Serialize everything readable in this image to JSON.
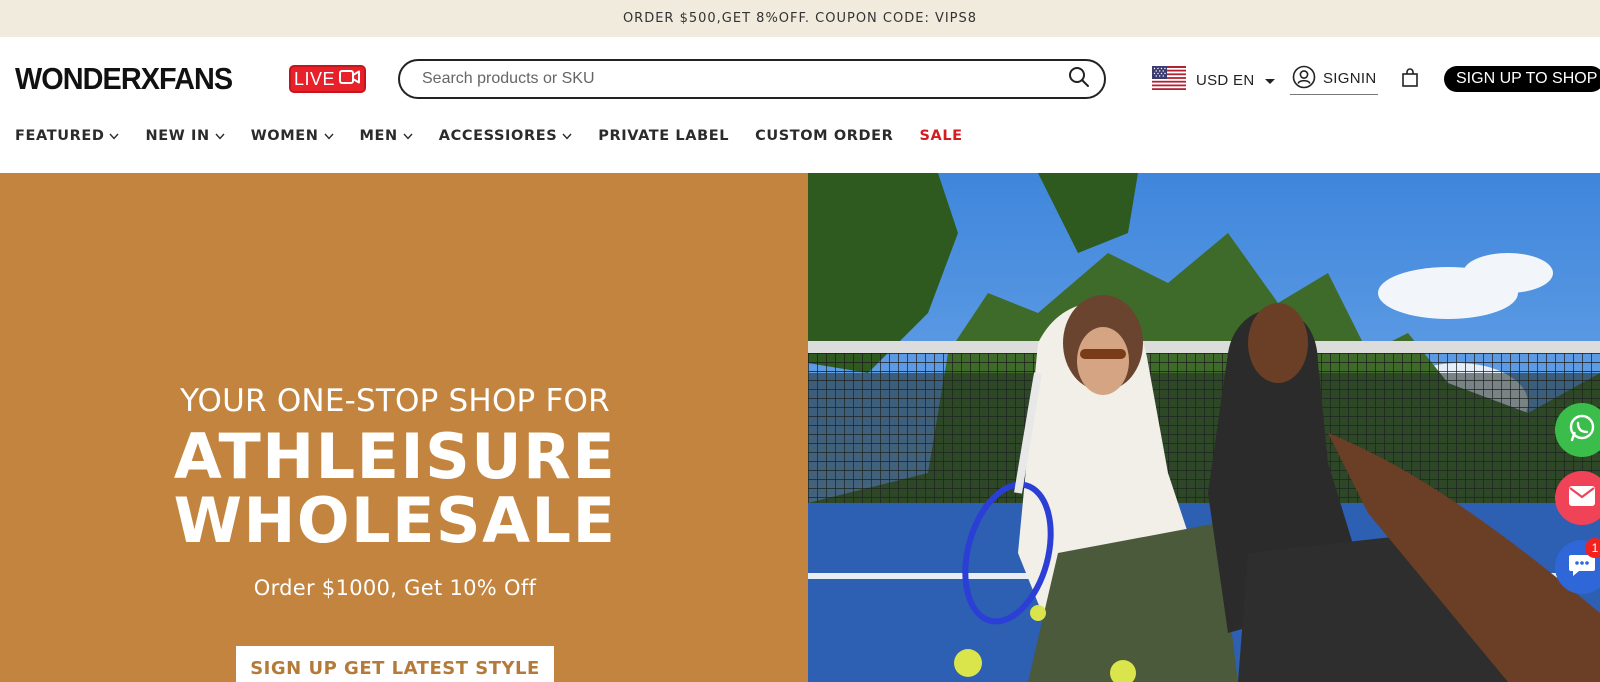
{
  "promo": {
    "text": "ORDER $500,GET 8%OFF. COUPON CODE: VIPS8"
  },
  "header": {
    "logo": "WONDERXFANS",
    "live_label": "LIVE",
    "search": {
      "placeholder": "Search products or SKU",
      "value": ""
    },
    "currency_label": "USD EN",
    "signin_label": "SIGNIN",
    "signup_label": "SIGN UP TO SHOP",
    "icons": [
      "video-camera-icon",
      "search-icon",
      "us-flag-icon",
      "caret-down-icon",
      "user-circle-icon",
      "shopping-bag-icon"
    ]
  },
  "nav": {
    "items": [
      {
        "label": "FEATURED",
        "dropdown": true
      },
      {
        "label": "NEW IN",
        "dropdown": true
      },
      {
        "label": "WOMEN",
        "dropdown": true
      },
      {
        "label": "MEN",
        "dropdown": true
      },
      {
        "label": "ACCESSIORES",
        "dropdown": true
      },
      {
        "label": "PRIVATE LABEL",
        "dropdown": false
      },
      {
        "label": "CUSTOM ORDER",
        "dropdown": false
      },
      {
        "label": "SALE",
        "dropdown": false
      }
    ],
    "sale_color": "#d21d22"
  },
  "hero": {
    "subtitle": "YOUR ONE-STOP SHOP FOR",
    "title_line1": "ATHLEISURE",
    "title_line2": "WHOLESALE",
    "offer": "Order $1000, Get 10% Off",
    "cta": "SIGN UP GET LATEST STYLE",
    "background_color": "#c3843f"
  },
  "floating": {
    "buttons": [
      "whatsapp-icon",
      "email-icon",
      "chat-icon"
    ],
    "chat_badge": "1"
  }
}
